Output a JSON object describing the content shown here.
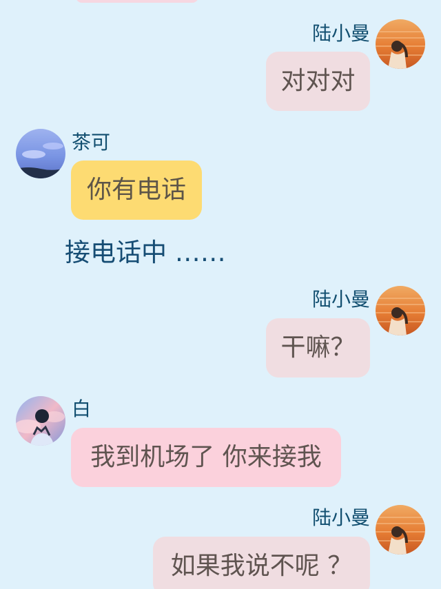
{
  "messages": [
    {
      "sender": "陆小曼",
      "text": "对对对",
      "side": "right"
    },
    {
      "sender": "茶可",
      "text": "你有电话",
      "side": "left"
    },
    {
      "status": "接电话中 ……"
    },
    {
      "sender": "陆小曼",
      "text": "干嘛？",
      "side": "right"
    },
    {
      "sender": "白",
      "text": "我到机场了 你来接我",
      "side": "left"
    },
    {
      "sender": "陆小曼",
      "text": "如果我说不呢 ？",
      "side": "right"
    }
  ],
  "colors": {
    "background": "#dff1fb",
    "name_text": "#124f70",
    "bubble_right": "#f0dde1",
    "bubble_yellow": "#fddb72",
    "bubble_pink": "#fbd1dc",
    "message_text": "#5f5450",
    "status_text": "#164d74"
  },
  "avatars": {
    "lu_xiaoman": "sunset-ocean-figure-avatar",
    "cha_ke": "blue-sky-avatar",
    "bai": "pink-cloud-boy-avatar"
  }
}
